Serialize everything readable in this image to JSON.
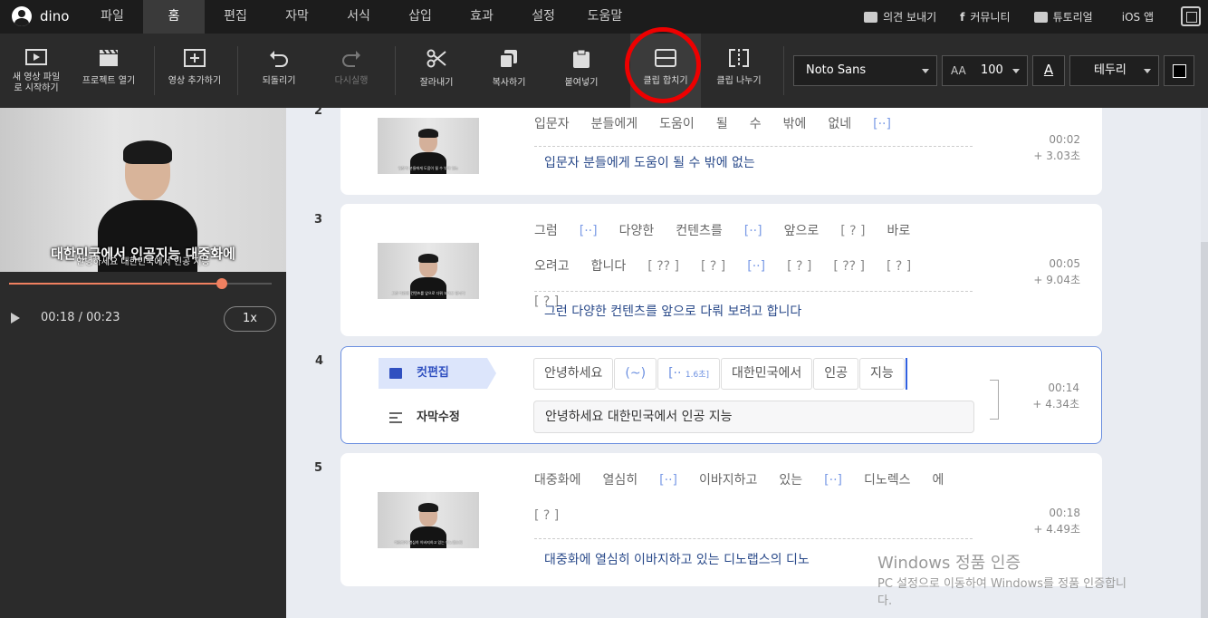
{
  "app": {
    "user": "dino"
  },
  "menu": [
    "파일",
    "홈",
    "편집",
    "자막",
    "서식",
    "삽입",
    "효과",
    "설정",
    "도움말"
  ],
  "menu_active": "홈",
  "toplinks": [
    "의견 보내기",
    "커뮤니티",
    "튜토리얼",
    "iOS 앱"
  ],
  "toolbar": {
    "new_video": "새 영상 파일로 시작하기",
    "open_project": "프로젝트 열기",
    "add_video": "영상 추가하기",
    "undo": "되돌리기",
    "redo": "다시실행",
    "cut": "잘라내기",
    "copy": "복사하기",
    "paste": "붙여넣기",
    "merge": "클립 합치기",
    "split": "클립 나누기",
    "font": "Noto Sans",
    "size": "100",
    "color_glyph": "A",
    "border": "테두리"
  },
  "player": {
    "subtitle_main": "대한민국에서 인공지능 대중화에",
    "subtitle_small": "안녕하세요 대한민국에서 인공 지능",
    "time": "00:18 / 00:23",
    "speed": "1x",
    "progress_fraction": 0.81
  },
  "clips": [
    {
      "num": "2",
      "thumb_text": "입문자 분들에게 도움이 될 수 밖에 없는",
      "words": [
        [
          "입문자",
          ""
        ],
        [
          "분들에게",
          ""
        ],
        [
          "도움이",
          ""
        ],
        [
          "될",
          ""
        ],
        [
          "수",
          ""
        ],
        [
          "밖에",
          ""
        ],
        [
          "없네",
          ""
        ],
        [
          "[··]",
          "br"
        ]
      ],
      "sentence": "입문자 분들에게 도움이 될 수 밖에 없는",
      "time": "00:02",
      "dur": "+ 3.03초"
    },
    {
      "num": "3",
      "thumb_text": "그런 다양한 컨텐츠를 앞으로 다뤄 보려고 합니다",
      "words": [
        [
          "그럼",
          ""
        ],
        [
          "[··]",
          "br"
        ],
        [
          "다양한",
          ""
        ],
        [
          "컨텐츠를",
          ""
        ],
        [
          "[··]",
          "br"
        ],
        [
          "앞으로",
          ""
        ],
        [
          "[ ? ]",
          "q"
        ],
        [
          "바로",
          ""
        ],
        [
          "오려고",
          ""
        ],
        [
          "합니다",
          ""
        ],
        [
          "[ ?? ]",
          "q"
        ],
        [
          "[ ? ]",
          "q"
        ],
        [
          "[··]",
          "br"
        ],
        [
          "[ ? ]",
          "q"
        ],
        [
          "[ ?? ]",
          "q"
        ],
        [
          "[ ? ]",
          "q"
        ],
        [
          "[ ? ]",
          "q"
        ]
      ],
      "sentence": "그런 다양한 컨텐츠를 앞으로 다뤄 보려고 합니다",
      "time": "00:05",
      "dur": "+ 9.04초"
    },
    {
      "num": "5",
      "thumb_text": "대중화에 열심히 이바지하고 있는 디노랩스의",
      "words": [
        [
          "대중화에",
          ""
        ],
        [
          "열심히",
          ""
        ],
        [
          "[··]",
          "br"
        ],
        [
          "이바지하고",
          ""
        ],
        [
          "있는",
          ""
        ],
        [
          "[··]",
          "br"
        ],
        [
          "디노렉스",
          ""
        ],
        [
          "에",
          ""
        ],
        [
          "[ ? ]",
          "q"
        ]
      ],
      "sentence": "대중화에 열심히 이바지하고 있는 디노랩스의 디노",
      "time": "00:18",
      "dur": "+ 4.49초"
    }
  ],
  "active_clip": {
    "num": "4",
    "tag_cut": "컷편집",
    "tag_sub": "자막수정",
    "chips": [
      {
        "label": "안녕하세요",
        "style": "",
        "extra": ""
      },
      {
        "label": "(~)",
        "style": "br",
        "extra": ""
      },
      {
        "label": "[·· ",
        "style": "br",
        "extra": "1.6초]"
      },
      {
        "label": "대한민국에서",
        "style": "",
        "extra": ""
      },
      {
        "label": "인공",
        "style": "",
        "extra": ""
      },
      {
        "label": "지능",
        "style": "",
        "extra": ""
      }
    ],
    "subtitle": "안녕하세요 대한민국에서 인공 지능",
    "time": "00:14",
    "dur": "+ 4.34초"
  },
  "watermark": {
    "title": "Windows 정품 인증",
    "line1": "PC 설정으로 이동하여 Windows를 정품 인증합니",
    "line2": "다."
  }
}
